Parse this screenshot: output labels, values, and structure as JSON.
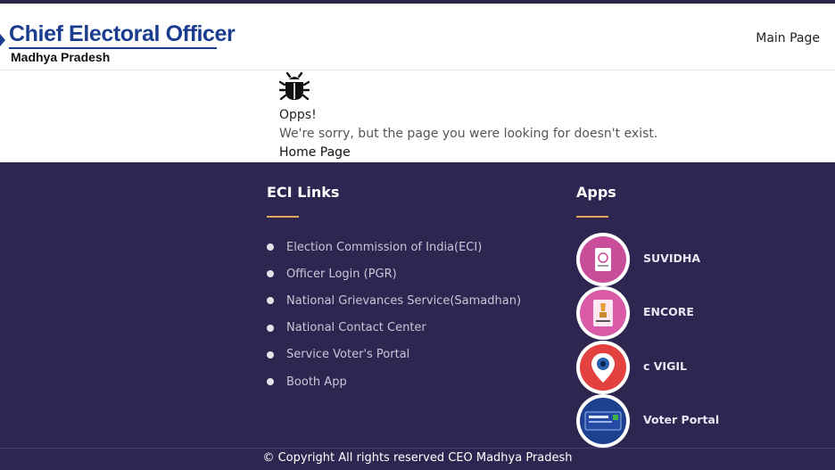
{
  "header": {
    "logo_title": "Chief Electoral Officer",
    "logo_subtitle": "Madhya Pradesh",
    "nav_main": "Main Page"
  },
  "error": {
    "icon": "bug-icon",
    "title": "Opps!",
    "message": "We're sorry, but the page you were looking for doesn't exist.",
    "home_link": "Home Page"
  },
  "footer": {
    "eci": {
      "title": "ECI Links",
      "links": [
        "Election Commission of India(ECI)",
        "Officer Login (PGR)",
        "National Grievances Service(Samadhan)",
        "National Contact Center",
        "Service Voter's Portal",
        "Booth App"
      ]
    },
    "apps": {
      "title": "Apps",
      "items": [
        {
          "name": "SUVIDHA",
          "icon": "suvidha-app-icon"
        },
        {
          "name": "ENCORE",
          "icon": "encore-app-icon"
        },
        {
          "name": "c VIGIL",
          "icon": "cvigil-app-icon"
        },
        {
          "name": "Voter Portal",
          "icon": "voter-portal-app-icon"
        }
      ]
    },
    "copyright": "© Copyright All rights reserved CEO Madhya Pradesh"
  },
  "colors": {
    "brand_blue": "#1b3d8f",
    "footer_bg": "#2c2650",
    "accent_rule": "#e2a35a"
  }
}
